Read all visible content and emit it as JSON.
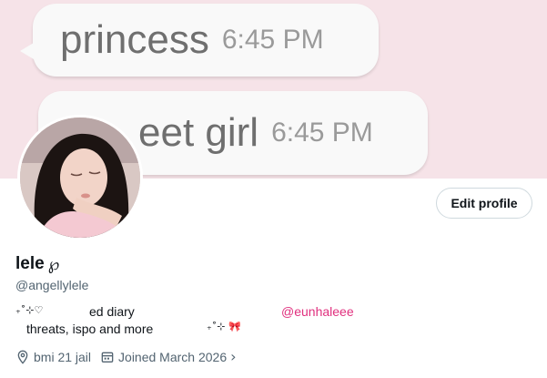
{
  "banner": {
    "bubble1": {
      "message": "princess",
      "time": "6:45 PM"
    },
    "bubble2": {
      "message": "eet girl",
      "time": "6:45 PM"
    },
    "background_color": "#f6e3e8"
  },
  "profile": {
    "display_name": "lele",
    "name_glyph": "℘",
    "handle": "@angellylele",
    "edit_button_label": "Edit profile"
  },
  "bio": {
    "line1_deco": "₊˚⊹♡",
    "line1_text": "ed diary",
    "mention": "@eunhaleee",
    "line2_text": "threats, ispo and more",
    "line2_deco": "₊˚⊹ 🎀"
  },
  "meta": {
    "location": "bmi 21 jail",
    "joined": "Joined March 2026",
    "chevron": "›"
  },
  "colors": {
    "accent_mention": "#e0307e",
    "secondary_text": "#536471"
  }
}
